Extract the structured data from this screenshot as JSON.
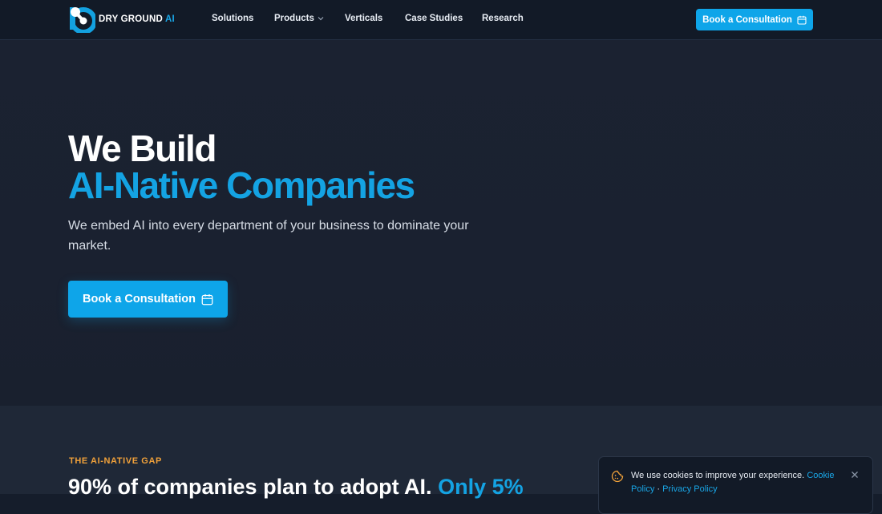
{
  "brand": {
    "name": "DRY GROUND",
    "name_accent": "AI",
    "accent_color": "#0ea5e9",
    "highlight_color": "#14a3e3",
    "eyebrow_color": "#f0a13a"
  },
  "nav": {
    "items": [
      {
        "label": "Solutions"
      },
      {
        "label": "Products",
        "has_dropdown": true,
        "icon": "chevron-down-icon"
      },
      {
        "label": "Verticals"
      },
      {
        "label": "Case Studies"
      },
      {
        "label": "Research"
      }
    ],
    "cta_label": "Book a Consultation",
    "cta_icon": "calendar-icon"
  },
  "hero": {
    "title_line1": "We Build",
    "title_line2": "AI-Native Companies",
    "subtitle": "We embed AI into every department of your business to dominate your market.",
    "cta_label": "Book a Consultation",
    "cta_icon": "calendar-icon"
  },
  "gap_section": {
    "eyebrow": "THE AI-NATIVE GAP",
    "title_start": "90% of companies plan to adopt AI.",
    "title_highlight": "Only 5%"
  },
  "cookie_banner": {
    "icon": "cookie-icon",
    "message": "We use cookies to improve your experience.",
    "cookie_policy_label": "Cookie Policy",
    "separator": "·",
    "privacy_policy_label": "Privacy Policy",
    "close_icon": "close-icon"
  }
}
